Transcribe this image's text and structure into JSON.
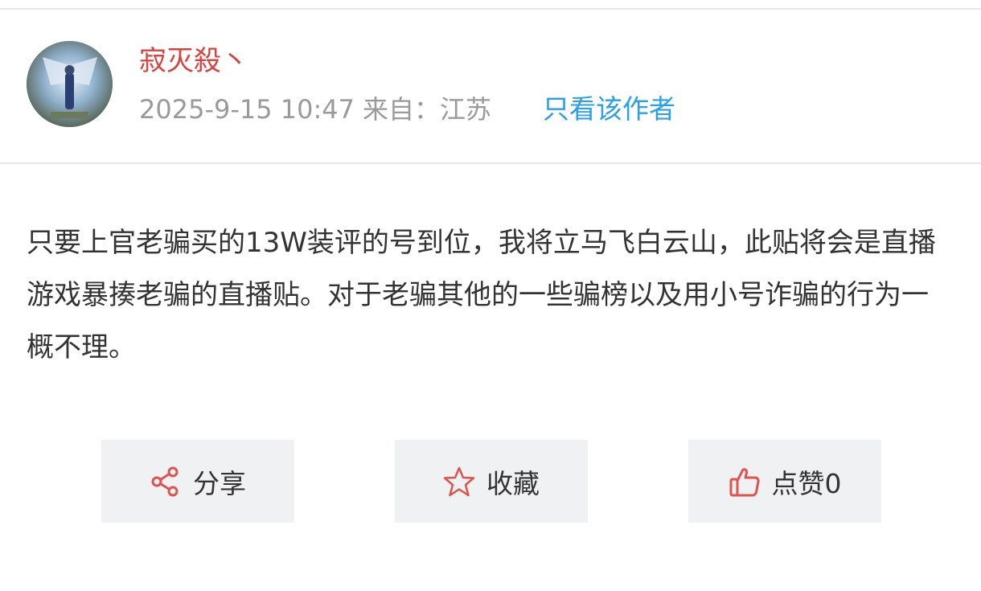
{
  "post": {
    "author": "寂灭殺丶",
    "datetime": "2025-9-15 10:47",
    "from_label": "来自：",
    "location": "江苏",
    "only_author": "只看该作者",
    "content": "只要上官老骗买的13W装评的号到位，我将立马飞白云山，此贴将会是直播游戏暴揍老骗的直播贴。对于老骗其他的一些骗榜以及用小号诈骗的行为一概不理。"
  },
  "actions": {
    "share": {
      "label": "分享",
      "icon": "share-icon"
    },
    "favorite": {
      "label": "收藏",
      "icon": "star-icon"
    },
    "like": {
      "label": "点赞0",
      "icon": "thumbs-up-icon"
    }
  },
  "colors": {
    "author": "#d9433f",
    "meta": "#9a9a9a",
    "link": "#2aa0e8",
    "icon": "#e0524e",
    "button_bg": "#f0f1f3"
  }
}
